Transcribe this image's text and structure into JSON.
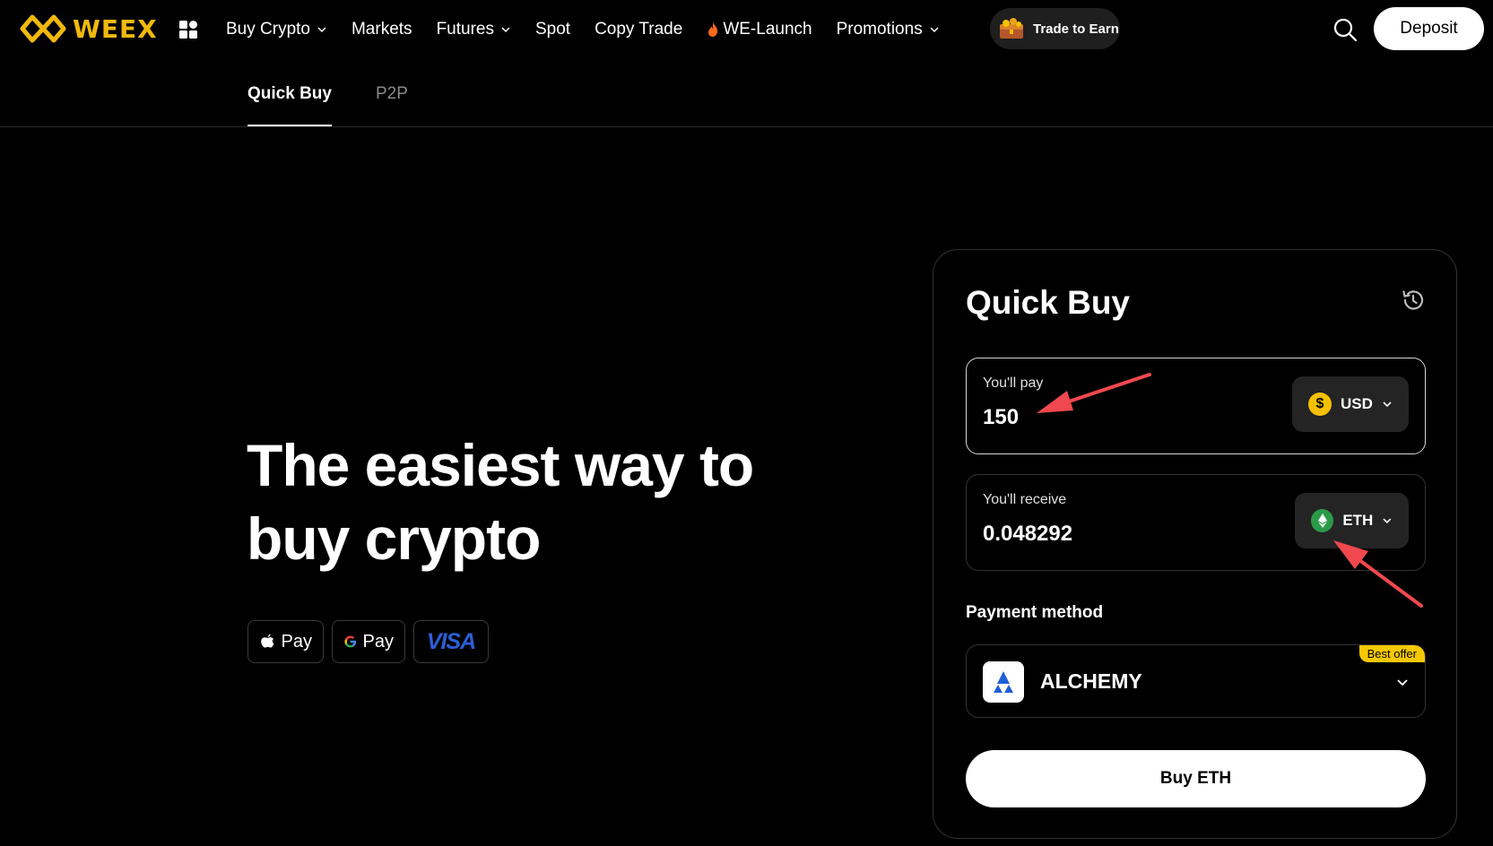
{
  "brand": {
    "name": "WEEX",
    "color": "#f0b90b"
  },
  "nav": {
    "items": [
      {
        "label": "Buy Crypto",
        "dropdown": true
      },
      {
        "label": "Markets",
        "dropdown": false
      },
      {
        "label": "Futures",
        "dropdown": true
      },
      {
        "label": "Spot",
        "dropdown": false
      },
      {
        "label": "Copy Trade",
        "dropdown": false
      },
      {
        "label": "WE-Launch",
        "dropdown": false,
        "icon": "flame-icon"
      },
      {
        "label": "Promotions",
        "dropdown": true
      }
    ],
    "trade_to_earn": "Trade to Earn",
    "deposit": "Deposit"
  },
  "subnav": {
    "tabs": [
      "Quick Buy",
      "P2P"
    ],
    "active": "Quick Buy"
  },
  "hero": {
    "title_line1": "The easiest way to",
    "title_line2": "buy crypto",
    "badges": {
      "apple": "Pay",
      "google": "Pay",
      "visa": "VISA"
    }
  },
  "card": {
    "title": "Quick Buy",
    "pay": {
      "label": "You'll pay",
      "value": "150",
      "currency": "USD",
      "currency_symbol": "$"
    },
    "receive": {
      "label": "You'll receive",
      "value": "0.048292",
      "currency": "ETH"
    },
    "payment_method_label": "Payment method",
    "payment_method": {
      "name": "ALCHEMY",
      "badge": "Best offer"
    },
    "buy_button": "Buy ETH"
  },
  "colors": {
    "accent": "#f0b90b",
    "eth": "#2b9a48",
    "usd": "#f5c000",
    "annotation": "#f0484e"
  }
}
